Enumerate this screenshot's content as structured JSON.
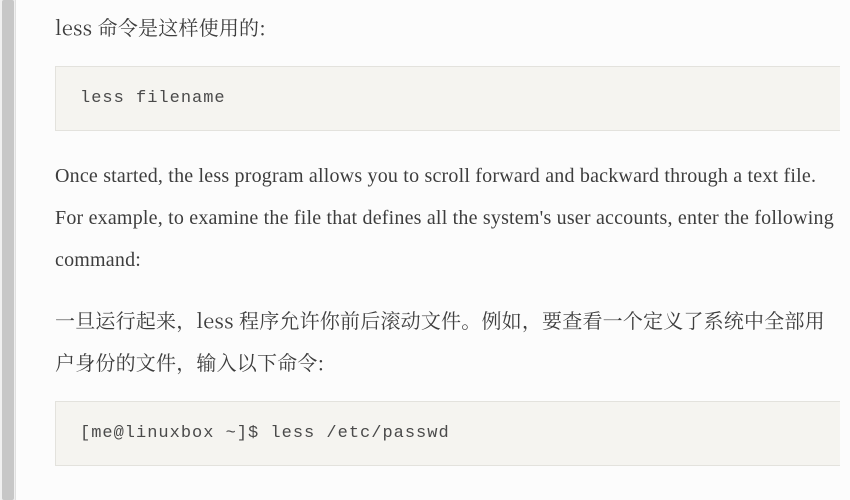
{
  "intro_cn": "less 命令是这样使用的:",
  "code1": "less filename",
  "para_en": "Once started, the less program allows you to scroll forward and backward through a text file. For example, to examine the file that defines all the system's user accounts, enter the following command:",
  "para_cn": "一旦运行起来，less 程序允许你前后滚动文件。例如，要查看一个定义了系统中全部用户身份的文件，输入以下命令:",
  "code2": "[me@linuxbox ~]$ less /etc/passwd"
}
